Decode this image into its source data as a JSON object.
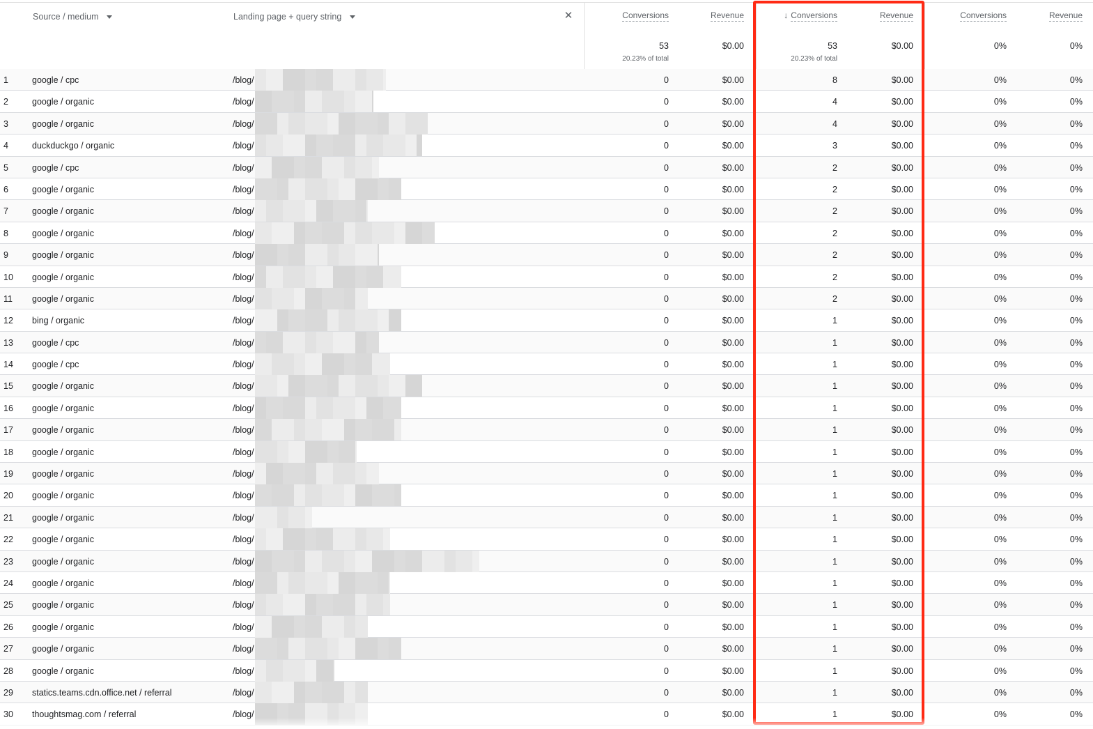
{
  "columns": {
    "source_medium": "Source / medium",
    "landing_page": "Landing page + query string",
    "group1": {
      "conversions": "Conversions",
      "revenue": "Revenue"
    },
    "group2": {
      "conversions": "Conversions",
      "revenue": "Revenue"
    },
    "group3": {
      "conversions": "Conversions",
      "revenue": "Revenue"
    }
  },
  "totals": {
    "g1_conversions": "53",
    "g1_conversions_pct": "20.23% of total",
    "g1_revenue": "$0.00",
    "g2_conversions": "53",
    "g2_conversions_pct": "20.23% of total",
    "g2_revenue": "$0.00",
    "g3_conversions": "0%",
    "g3_revenue": "0%"
  },
  "icons": {
    "sort": "arrow-down-icon",
    "remove": "close-icon",
    "dropdown": "caret-down-icon"
  },
  "highlight_color": "#ff2a14",
  "rows": [
    {
      "idx": "1",
      "src": "google / cpc",
      "page": "/blog/",
      "c1": "0",
      "r1": "$0.00",
      "c2": "8",
      "r2": "$0.00",
      "c3": "0%",
      "r3": "0%"
    },
    {
      "idx": "2",
      "src": "google / organic",
      "page": "/blog/",
      "c1": "0",
      "r1": "$0.00",
      "c2": "4",
      "r2": "$0.00",
      "c3": "0%",
      "r3": "0%"
    },
    {
      "idx": "3",
      "src": "google / organic",
      "page": "/blog/",
      "c1": "0",
      "r1": "$0.00",
      "c2": "4",
      "r2": "$0.00",
      "c3": "0%",
      "r3": "0%"
    },
    {
      "idx": "4",
      "src": "duckduckgo / organic",
      "page": "/blog/",
      "c1": "0",
      "r1": "$0.00",
      "c2": "3",
      "r2": "$0.00",
      "c3": "0%",
      "r3": "0%"
    },
    {
      "idx": "5",
      "src": "google / cpc",
      "page": "/blog/",
      "c1": "0",
      "r1": "$0.00",
      "c2": "2",
      "r2": "$0.00",
      "c3": "0%",
      "r3": "0%"
    },
    {
      "idx": "6",
      "src": "google / organic",
      "page": "/blog/",
      "c1": "0",
      "r1": "$0.00",
      "c2": "2",
      "r2": "$0.00",
      "c3": "0%",
      "r3": "0%"
    },
    {
      "idx": "7",
      "src": "google / organic",
      "page": "/blog/",
      "c1": "0",
      "r1": "$0.00",
      "c2": "2",
      "r2": "$0.00",
      "c3": "0%",
      "r3": "0%"
    },
    {
      "idx": "8",
      "src": "google / organic",
      "page": "/blog/",
      "c1": "0",
      "r1": "$0.00",
      "c2": "2",
      "r2": "$0.00",
      "c3": "0%",
      "r3": "0%"
    },
    {
      "idx": "9",
      "src": "google / organic",
      "page": "/blog/",
      "c1": "0",
      "r1": "$0.00",
      "c2": "2",
      "r2": "$0.00",
      "c3": "0%",
      "r3": "0%"
    },
    {
      "idx": "10",
      "src": "google / organic",
      "page": "/blog/",
      "c1": "0",
      "r1": "$0.00",
      "c2": "2",
      "r2": "$0.00",
      "c3": "0%",
      "r3": "0%"
    },
    {
      "idx": "11",
      "src": "google / organic",
      "page": "/blog/",
      "c1": "0",
      "r1": "$0.00",
      "c2": "2",
      "r2": "$0.00",
      "c3": "0%",
      "r3": "0%"
    },
    {
      "idx": "12",
      "src": "bing / organic",
      "page": "/blog/",
      "c1": "0",
      "r1": "$0.00",
      "c2": "1",
      "r2": "$0.00",
      "c3": "0%",
      "r3": "0%"
    },
    {
      "idx": "13",
      "src": "google / cpc",
      "page": "/blog/",
      "c1": "0",
      "r1": "$0.00",
      "c2": "1",
      "r2": "$0.00",
      "c3": "0%",
      "r3": "0%"
    },
    {
      "idx": "14",
      "src": "google / cpc",
      "page": "/blog/",
      "c1": "0",
      "r1": "$0.00",
      "c2": "1",
      "r2": "$0.00",
      "c3": "0%",
      "r3": "0%"
    },
    {
      "idx": "15",
      "src": "google / organic",
      "page": "/blog/",
      "c1": "0",
      "r1": "$0.00",
      "c2": "1",
      "r2": "$0.00",
      "c3": "0%",
      "r3": "0%"
    },
    {
      "idx": "16",
      "src": "google / organic",
      "page": "/blog/",
      "c1": "0",
      "r1": "$0.00",
      "c2": "1",
      "r2": "$0.00",
      "c3": "0%",
      "r3": "0%"
    },
    {
      "idx": "17",
      "src": "google / organic",
      "page": "/blog/",
      "c1": "0",
      "r1": "$0.00",
      "c2": "1",
      "r2": "$0.00",
      "c3": "0%",
      "r3": "0%"
    },
    {
      "idx": "18",
      "src": "google / organic",
      "page": "/blog/",
      "c1": "0",
      "r1": "$0.00",
      "c2": "1",
      "r2": "$0.00",
      "c3": "0%",
      "r3": "0%"
    },
    {
      "idx": "19",
      "src": "google / organic",
      "page": "/blog/",
      "c1": "0",
      "r1": "$0.00",
      "c2": "1",
      "r2": "$0.00",
      "c3": "0%",
      "r3": "0%"
    },
    {
      "idx": "20",
      "src": "google / organic",
      "page": "/blog/",
      "c1": "0",
      "r1": "$0.00",
      "c2": "1",
      "r2": "$0.00",
      "c3": "0%",
      "r3": "0%"
    },
    {
      "idx": "21",
      "src": "google / organic",
      "page": "/blog/",
      "c1": "0",
      "r1": "$0.00",
      "c2": "1",
      "r2": "$0.00",
      "c3": "0%",
      "r3": "0%"
    },
    {
      "idx": "22",
      "src": "google / organic",
      "page": "/blog/",
      "c1": "0",
      "r1": "$0.00",
      "c2": "1",
      "r2": "$0.00",
      "c3": "0%",
      "r3": "0%"
    },
    {
      "idx": "23",
      "src": "google / organic",
      "page": "/blog/",
      "c1": "0",
      "r1": "$0.00",
      "c2": "1",
      "r2": "$0.00",
      "c3": "0%",
      "r3": "0%"
    },
    {
      "idx": "24",
      "src": "google / organic",
      "page": "/blog/",
      "c1": "0",
      "r1": "$0.00",
      "c2": "1",
      "r2": "$0.00",
      "c3": "0%",
      "r3": "0%"
    },
    {
      "idx": "25",
      "src": "google / organic",
      "page": "/blog/",
      "c1": "0",
      "r1": "$0.00",
      "c2": "1",
      "r2": "$0.00",
      "c3": "0%",
      "r3": "0%"
    },
    {
      "idx": "26",
      "src": "google / organic",
      "page": "/blog/",
      "c1": "0",
      "r1": "$0.00",
      "c2": "1",
      "r2": "$0.00",
      "c3": "0%",
      "r3": "0%"
    },
    {
      "idx": "27",
      "src": "google / organic",
      "page": "/blog/",
      "c1": "0",
      "r1": "$0.00",
      "c2": "1",
      "r2": "$0.00",
      "c3": "0%",
      "r3": "0%"
    },
    {
      "idx": "28",
      "src": "google / organic",
      "page": "/blog/",
      "c1": "0",
      "r1": "$0.00",
      "c2": "1",
      "r2": "$0.00",
      "c3": "0%",
      "r3": "0%"
    },
    {
      "idx": "29",
      "src": "statics.teams.cdn.office.net / referral",
      "page": "/blog/",
      "c1": "0",
      "r1": "$0.00",
      "c2": "1",
      "r2": "$0.00",
      "c3": "0%",
      "r3": "0%"
    },
    {
      "idx": "30",
      "src": "thoughtsmag.com / referral",
      "page": "/blog/",
      "c1": "0",
      "r1": "$0.00",
      "c2": "1",
      "r2": "$0.00",
      "c3": "0%",
      "r3": "0%"
    }
  ]
}
